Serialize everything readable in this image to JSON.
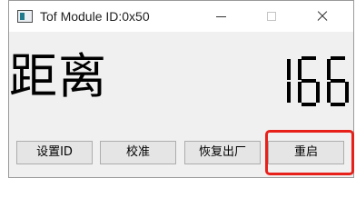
{
  "window": {
    "title": "Tof Module ID:0x50",
    "icons": {
      "app": "app-window-icon",
      "minimize": "minimize-icon",
      "maximize": "maximize-icon",
      "close": "close-icon"
    }
  },
  "display": {
    "label": "距离",
    "value": "166",
    "value_style": "seven-segment-lcd"
  },
  "buttons": {
    "set_id": "设置ID",
    "calibrate": "校准",
    "factory_reset": "恢复出厂",
    "reboot": "重启"
  },
  "annotation": {
    "highlighted_control": "reboot-button",
    "color": "#e8201a"
  }
}
